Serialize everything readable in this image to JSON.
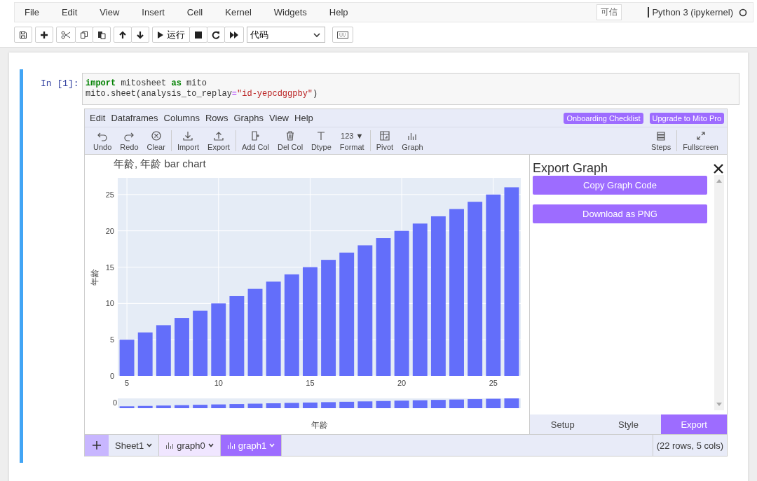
{
  "menubar": {
    "items": [
      "File",
      "Edit",
      "View",
      "Insert",
      "Cell",
      "Kernel",
      "Widgets",
      "Help"
    ],
    "trusted": "可信",
    "kernel": "Python 3 (ipykernel)"
  },
  "toolbar": {
    "run_label": "运行",
    "cell_type": "代码"
  },
  "cell": {
    "prompt": "In [1]:",
    "code": [
      [
        {
          "text": "import",
          "kind": "keyword"
        },
        {
          "text": " mitosheet ",
          "kind": "plain"
        },
        {
          "text": "as",
          "kind": "keyword"
        },
        {
          "text": " mito",
          "kind": "plain"
        }
      ],
      [
        {
          "text": "mito.sheet(analysis_to_replay",
          "kind": "plain"
        },
        {
          "text": "=",
          "kind": "operator"
        },
        {
          "text": "\"id-yepcdggpby\"",
          "kind": "string"
        },
        {
          "text": ")",
          "kind": "plain"
        }
      ]
    ]
  },
  "mito": {
    "menu": [
      "Edit",
      "Dataframes",
      "Columns",
      "Rows",
      "Graphs",
      "View",
      "Help"
    ],
    "badges": [
      "Onboarding Checklist",
      "Upgrade to Mito Pro"
    ],
    "tools": [
      {
        "label": "Undo"
      },
      {
        "label": "Redo"
      },
      {
        "label": "Clear"
      },
      {
        "label": "Import"
      },
      {
        "label": "Export"
      },
      {
        "label": "Add Col"
      },
      {
        "label": "Del Col"
      },
      {
        "label": "Dtype"
      },
      {
        "label": "Format",
        "glyph": "123 ▼"
      },
      {
        "label": "Pivot"
      },
      {
        "label": "Graph"
      }
    ],
    "tools_right": [
      {
        "label": "Steps"
      },
      {
        "label": "Fullscreen"
      }
    ],
    "graph": {
      "range_slider_label": "0",
      "chart_data": {
        "type": "bar",
        "title": "年龄, 年龄 bar chart",
        "xlabel": "年龄",
        "ylabel": "年龄",
        "x": [
          5,
          6,
          7,
          8,
          9,
          10,
          11,
          12,
          13,
          14,
          15,
          16,
          17,
          18,
          19,
          20,
          21,
          22,
          23,
          24,
          25,
          26
        ],
        "grid": true,
        "series": [
          {
            "color": "#636efa",
            "values": [
              5,
              6,
              7,
              8,
              9,
              10,
              11,
              12,
              13,
              14,
              15,
              16,
              17,
              18,
              19,
              20,
              21,
              22,
              23,
              24,
              25,
              26
            ]
          }
        ],
        "xlim": [
          4.5,
          26.5
        ],
        "ylim": [
          0,
          27.3
        ],
        "xticks": [
          5,
          10,
          15,
          20,
          25
        ],
        "yticks": [
          0,
          5,
          10,
          15,
          20,
          25
        ]
      }
    },
    "export": {
      "title": "Export Graph",
      "buttons": [
        "Copy Graph Code",
        "Download as PNG"
      ],
      "tabs": [
        {
          "label": "Setup",
          "selected": false
        },
        {
          "label": "Style",
          "selected": false
        },
        {
          "label": "Export",
          "selected": true
        }
      ]
    },
    "sheet_tabs": [
      {
        "label": "Sheet1",
        "kind": "sheet",
        "selected": false
      },
      {
        "label": "graph0",
        "kind": "graph",
        "selected": false
      },
      {
        "label": "graph1",
        "kind": "graph",
        "selected": true
      }
    ],
    "status": "(22 rows, 5 cols)"
  }
}
